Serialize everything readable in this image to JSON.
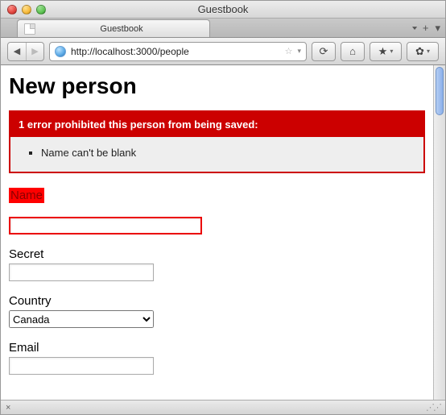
{
  "window": {
    "title": "Guestbook"
  },
  "tab": {
    "title": "Guestbook"
  },
  "url": "http://localhost:3000/people",
  "page": {
    "heading": "New person",
    "error": {
      "header": "1 error prohibited this person from being saved:",
      "messages": [
        "Name can't be blank"
      ]
    },
    "fields": {
      "name": {
        "label": "Name",
        "value": "",
        "error": true
      },
      "secret": {
        "label": "Secret",
        "value": ""
      },
      "country": {
        "label": "Country",
        "selected": "Canada"
      },
      "email": {
        "label": "Email",
        "value": ""
      }
    }
  },
  "icons": {
    "back": "◀",
    "forward": "▶",
    "reload": "⟳",
    "home": "⌂",
    "bookmark": "★",
    "gear": "✿",
    "plus": "+",
    "chev": "▾",
    "star_outline": "☆",
    "status_x": "×",
    "grip": "⋰⋰"
  }
}
